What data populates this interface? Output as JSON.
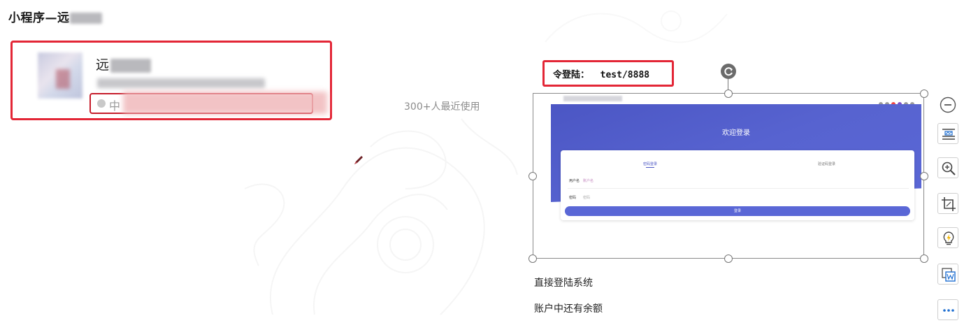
{
  "page": {
    "title": "小程序—远"
  },
  "card": {
    "name_visible": "远",
    "status_label": "中"
  },
  "usage": {
    "text": "300+人最近使用"
  },
  "login": {
    "label": "令登陆：  test/8888"
  },
  "embedded": {
    "welcome": "欢迎登录",
    "tab_active": "密码登录",
    "tab_other": "验证码登录",
    "username_label": "用户名",
    "username_placeholder": "账户名",
    "password_label": "密码",
    "password_placeholder": "密码",
    "login_button": "登录"
  },
  "notes": {
    "line1": "直接登陆系统",
    "line2": "账户中还有余额"
  },
  "toolbar": {
    "icons": [
      "minus-circle-icon",
      "layout-options-icon",
      "zoom-in-icon",
      "crop-icon",
      "idea-icon",
      "word-embed-icon",
      "more-icon"
    ]
  },
  "colors": {
    "highlight": "#e32636",
    "brand": "#4b56c4"
  }
}
